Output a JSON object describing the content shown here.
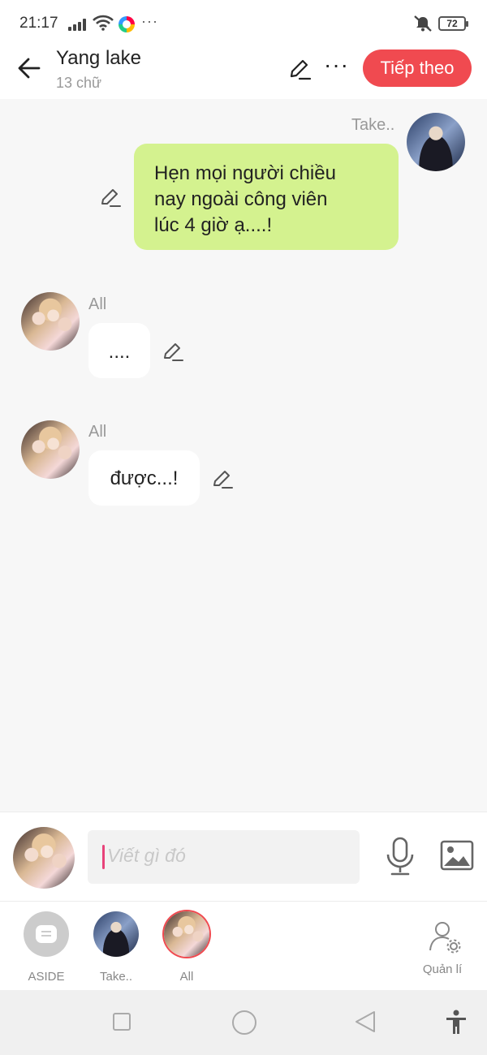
{
  "status_bar": {
    "time": "21:17",
    "more": "···",
    "battery": "72"
  },
  "header": {
    "title": "Yang lake",
    "subtitle": "13 chữ",
    "next_label": "Tiếp theo",
    "more": "···"
  },
  "messages": [
    {
      "sender": "Take..",
      "side": "right",
      "text_lines": [
        "Hẹn mọi người chiều",
        "nay ngoài công viên",
        "lúc 4 giờ ạ....!"
      ]
    },
    {
      "sender": "All",
      "side": "left",
      "text": "...."
    },
    {
      "sender": "All",
      "side": "left",
      "text": "được...!"
    }
  ],
  "compose": {
    "placeholder": "Viết gì đó"
  },
  "tabs": [
    {
      "label": "ASIDE"
    },
    {
      "label": "Take.."
    },
    {
      "label": "All",
      "selected": true
    }
  ],
  "manage_label": "Quản lí",
  "colors": {
    "accent": "#f04a50",
    "own_bubble": "#d4f28f",
    "other_bubble": "#ffffff",
    "background": "#f7f7f7",
    "caret": "#e8437a"
  },
  "icons": [
    "back-arrow-icon",
    "pencil-icon",
    "more-icon",
    "mic-icon",
    "image-icon",
    "manage-user-icon",
    "accessibility-icon"
  ]
}
